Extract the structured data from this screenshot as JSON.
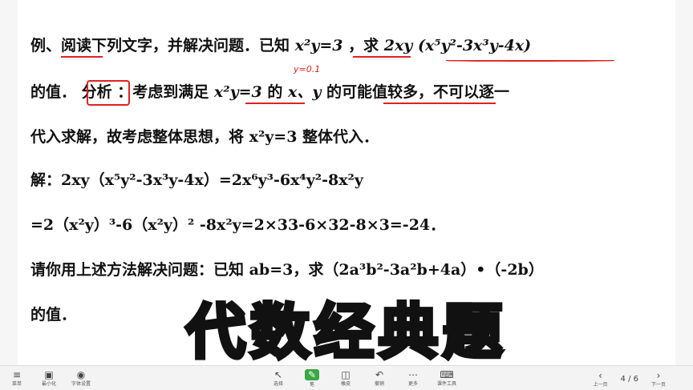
{
  "content": {
    "line1": {
      "pre": "例、阅读下列文字，并解决问题．已知",
      "cond": "x²y=3",
      "mid": "，求",
      "expr": "2xy (x⁵y²-3x³y-4x)"
    },
    "line2": {
      "pre": "的值．",
      "label": "分析",
      "post1": "：考虑到满足",
      "cond": "x²y=3",
      "post2": "的",
      "vars": "x、y",
      "post3": "的可能值较多，不可以逐一"
    },
    "line3": "代入求解，故考虑整体思想，将 x²y=3 整体代入．",
    "line4": "解：2xy（x⁵y²-3x³y-4x）=2x⁶y³-6x⁴y²-8x²y",
    "line5": "=2（x²y）³-6（x²y）² -8x²y=2×33-6×32-8×3=-24．",
    "line6": "请你用上述方法解决问题：已知 ab=3，求（2a³b²-3a²b+4a）•（-2b）",
    "line7": "的值．",
    "annotation": "y=0.1"
  },
  "overlay_title": "代数经典题",
  "toolbar": {
    "left": [
      {
        "icon": "≡",
        "label": "菜单"
      },
      {
        "icon": "▣",
        "label": "最小化"
      },
      {
        "icon": "◉",
        "label": "字体设置"
      }
    ],
    "center": [
      {
        "icon": "↖",
        "label": "选择"
      },
      {
        "icon": "✎",
        "label": "笔"
      },
      {
        "icon": "◫",
        "label": "橡皮"
      },
      {
        "icon": "↶",
        "label": "撤销"
      },
      {
        "icon": "⋯",
        "label": "更多"
      },
      {
        "icon": "⌨",
        "label": "课件工具"
      }
    ],
    "page": "4 / 6",
    "prev_label": "上一页",
    "next_label": "下一页"
  }
}
